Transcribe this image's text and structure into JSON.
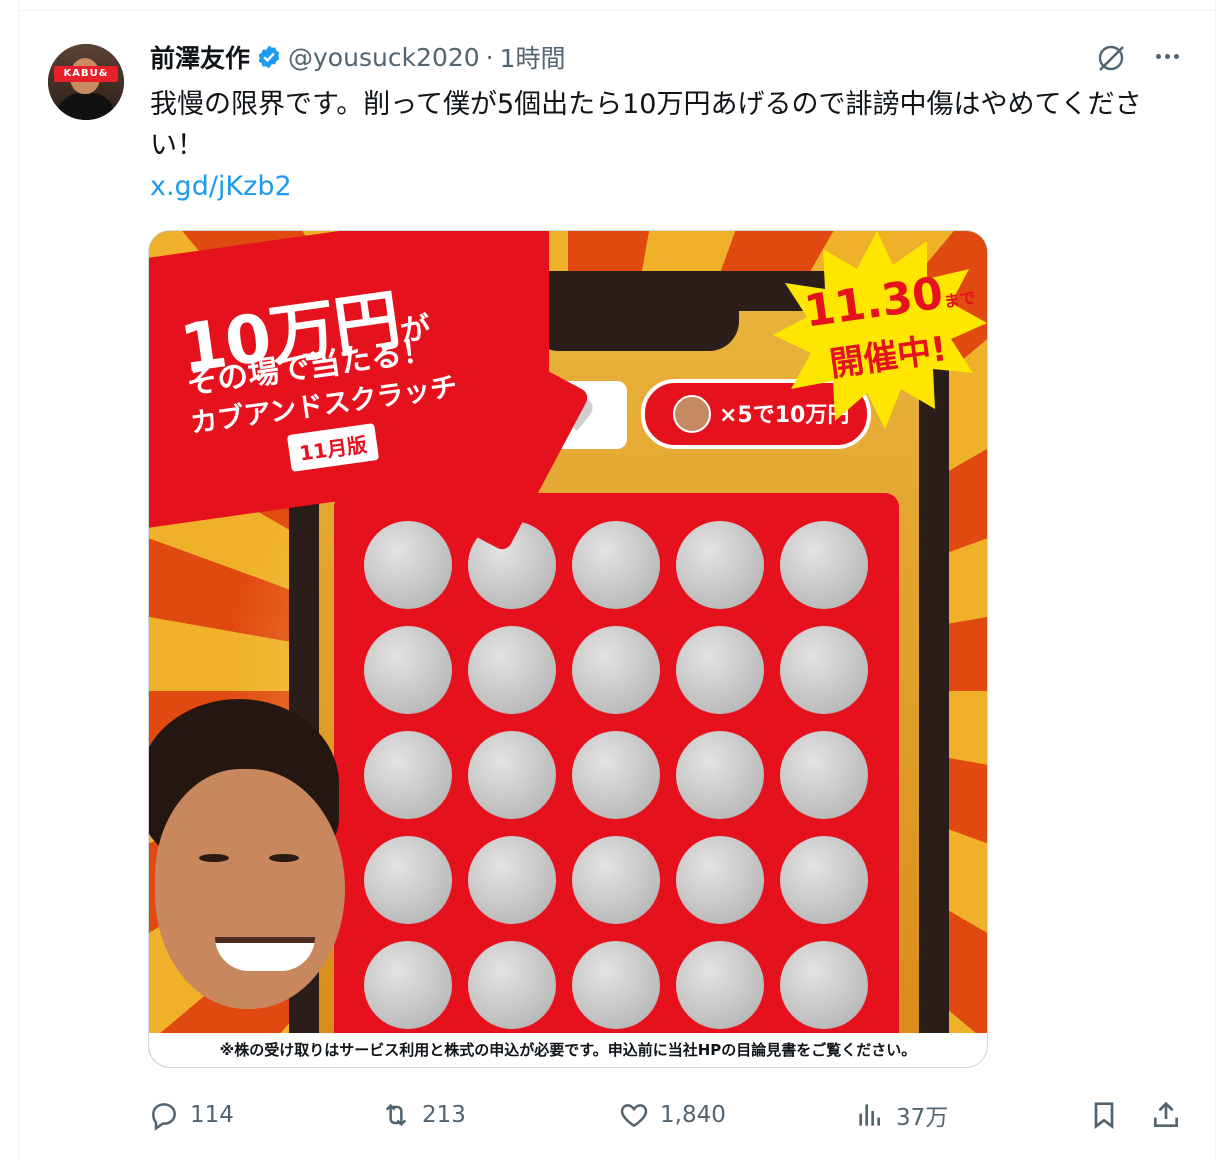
{
  "post": {
    "author_name": "前澤友作",
    "handle": "@yousuck2020",
    "separator": "·",
    "time": "1時間",
    "text": "我慢の限界です。削って僕が5個出たら10万円あげるので誹謗中傷はやめてください！",
    "link": "x.gd/jKzb2"
  },
  "image": {
    "promo_main": "10万円",
    "promo_ga": "が",
    "promo_sub1": "その場で当たる！",
    "promo_sub2": "カブアンドスクラッチ",
    "promo_tag": "11月版",
    "burst_date": "11.30",
    "burst_made": "まで",
    "burst_open": "開催中!",
    "bubble": "×5で10万円",
    "disclaimer": "※株の受け取りはサービス利用と株式の申込が必要です。申込前に当社HPの目論見書をご覧ください。",
    "scratch_grid": {
      "rows": 5,
      "cols": 5
    }
  },
  "actions": {
    "replies": "114",
    "reposts": "213",
    "likes": "1,840",
    "views": "37万"
  },
  "colors": {
    "link": "#1d9bf0",
    "secondary_text": "#536471",
    "verified": "#1d9bf0",
    "promo_red": "#e5121e"
  },
  "icons": [
    "verified-badge-icon",
    "grok-icon",
    "more-icon",
    "reply-icon",
    "repost-icon",
    "like-icon",
    "views-icon",
    "bookmark-icon",
    "share-icon"
  ]
}
